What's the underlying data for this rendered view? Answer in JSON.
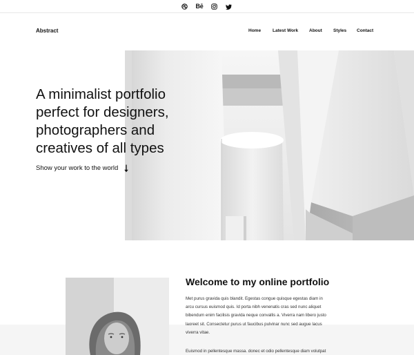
{
  "topbar": {
    "social": [
      {
        "icon": "dribbble-icon"
      },
      {
        "icon": "behance-icon",
        "text": "Bē"
      },
      {
        "icon": "instagram-icon"
      },
      {
        "icon": "twitter-icon"
      }
    ]
  },
  "header": {
    "logo": "Abstract",
    "nav": [
      "Home",
      "Latest Work",
      "About",
      "Styles",
      "Contact"
    ]
  },
  "hero": {
    "title_lines": [
      "A minimalist portfolio",
      "perfect for designers,",
      "photographers and",
      "creatives of all types"
    ],
    "link": "Show your work to the world",
    "arrow_icon": "arrow-down-icon"
  },
  "welcome": {
    "title": "Welcome to my online portfolio",
    "para1_lines": [
      "Met purus gravida quis blandit. Egestas congue quisque egestas diam in",
      "arcu cursus euismod quis. Id porta nibh venenatis cras sed nunc aliquet",
      "bibendum enim facilisis gravida neque convallis a. Viverra nam libero justo",
      "laoreet sit. Consectetur purus ut faucibus pulvinar nunc sed augue lacus",
      "viverra vitae."
    ],
    "para2_lines": [
      "Euismod in pellentesque massa. donec et odio pellentesque diam volutpat"
    ]
  },
  "colors": {
    "text": "#111111",
    "divider": "#e7e7e7",
    "band": "#f5f5f5"
  }
}
